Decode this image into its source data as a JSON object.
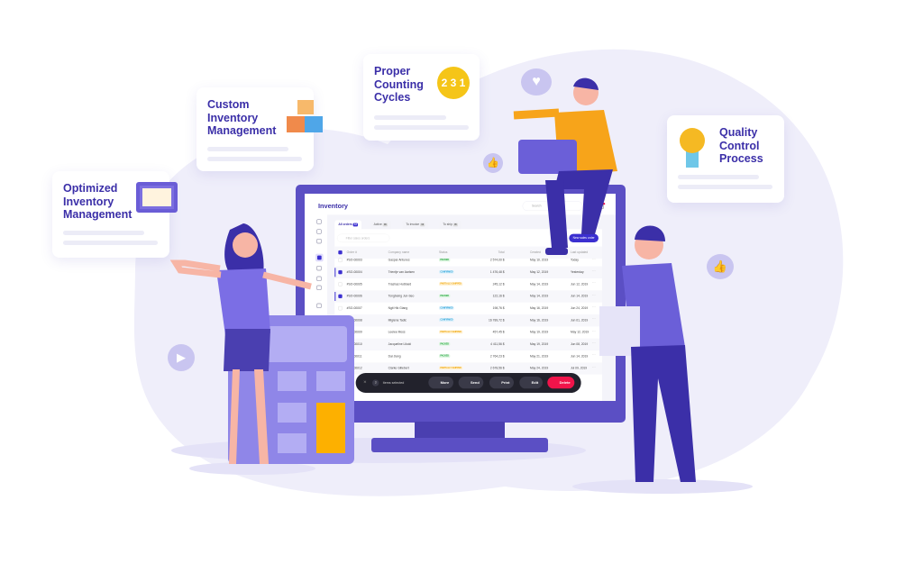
{
  "bubbles": {
    "optimized": "Optimized Inventory Management",
    "custom": "Custom Inventory Management",
    "counting": "Proper Counting Cycles",
    "quality": "Quality Control Process"
  },
  "colors": {
    "primary": "#5b4fc4",
    "accent": "#3b2fd0",
    "delete": "#f0144a",
    "background": "#efeefa"
  },
  "app": {
    "title": "Inventory",
    "search_placeholder": "Search",
    "tabs": [
      {
        "label": "All orders",
        "count": "12"
      },
      {
        "label": "Active",
        "count": "08"
      },
      {
        "label": "To invoice",
        "count": "03"
      },
      {
        "label": "To ship",
        "count": "05"
      }
    ],
    "filter_placeholder": "Filter sales orders",
    "new_order_button": "New sales order",
    "columns": [
      "Order #",
      "Company name",
      "Status",
      "Total",
      "Created",
      "Last updated"
    ],
    "rows": [
      {
        "order": "#SO-00003",
        "company": "Gaspar Antunes",
        "status": "PACKED",
        "total": "2 574,00 $",
        "created": "May 10, 2019",
        "updated": "Today",
        "checked": false
      },
      {
        "order": "#SO-00004",
        "company": "Trientje van Aarlsen",
        "status": "CONFIRMED",
        "total": "1 476,48 $",
        "created": "May 12, 2019",
        "updated": "Yesterday",
        "checked": true
      },
      {
        "order": "#SO-00005",
        "company": "Trashas Hubbard",
        "status": "PARTIALLY SHIPPED",
        "total": "245,12 $",
        "created": "May 14, 2019",
        "updated": "Jun 12, 2019",
        "checked": false
      },
      {
        "order": "#SO-00006",
        "company": "Tongbeing Jun-Seo",
        "status": "PACKED",
        "total": "122,16 $",
        "created": "May 14, 2019",
        "updated": "Jun 14, 2019",
        "checked": true
      },
      {
        "order": "#SO-00007",
        "company": "Ngit Hik Giang",
        "status": "CONFIRMED",
        "total": "198,76 $",
        "created": "May 16, 2019",
        "updated": "Jun 24, 2019",
        "checked": false
      },
      {
        "order": "#SO-00008",
        "company": "Migiena Tadic",
        "status": "CONFIRMED",
        "total": "16 789,72 $",
        "created": "May 16, 2019",
        "updated": "Jun 01, 2019",
        "checked": false
      },
      {
        "order": "#SO-00009",
        "company": "Leelee Moss",
        "status": "PARTIALLY SHIPPED",
        "total": "457,45 $",
        "created": "May 19, 2019",
        "updated": "May 12, 2019",
        "checked": false
      },
      {
        "order": "#SO-00010",
        "company": "Jacqueline Likoki",
        "status": "PACKED",
        "total": "4 411,56 $",
        "created": "May 19, 2019",
        "updated": "Jun 08, 2019",
        "checked": false
      },
      {
        "order": "#SO-00011",
        "company": "Dai Jiang",
        "status": "PACKED",
        "total": "2 764,23 $",
        "created": "May 21, 2019",
        "updated": "Jun 14, 2019",
        "checked": false
      },
      {
        "order": "#SO-00012",
        "company": "Clarke Gillebert",
        "status": "PARTIALLY SHIPPED",
        "total": "2 678,56 $",
        "created": "May 24, 2019",
        "updated": "Jul 09, 2019",
        "checked": false
      }
    ],
    "toolbar": {
      "count": "3",
      "selected_label": "Items selected",
      "more": "More",
      "send": "Send",
      "print": "Print",
      "edit": "Edit",
      "delete": "Delete"
    }
  }
}
